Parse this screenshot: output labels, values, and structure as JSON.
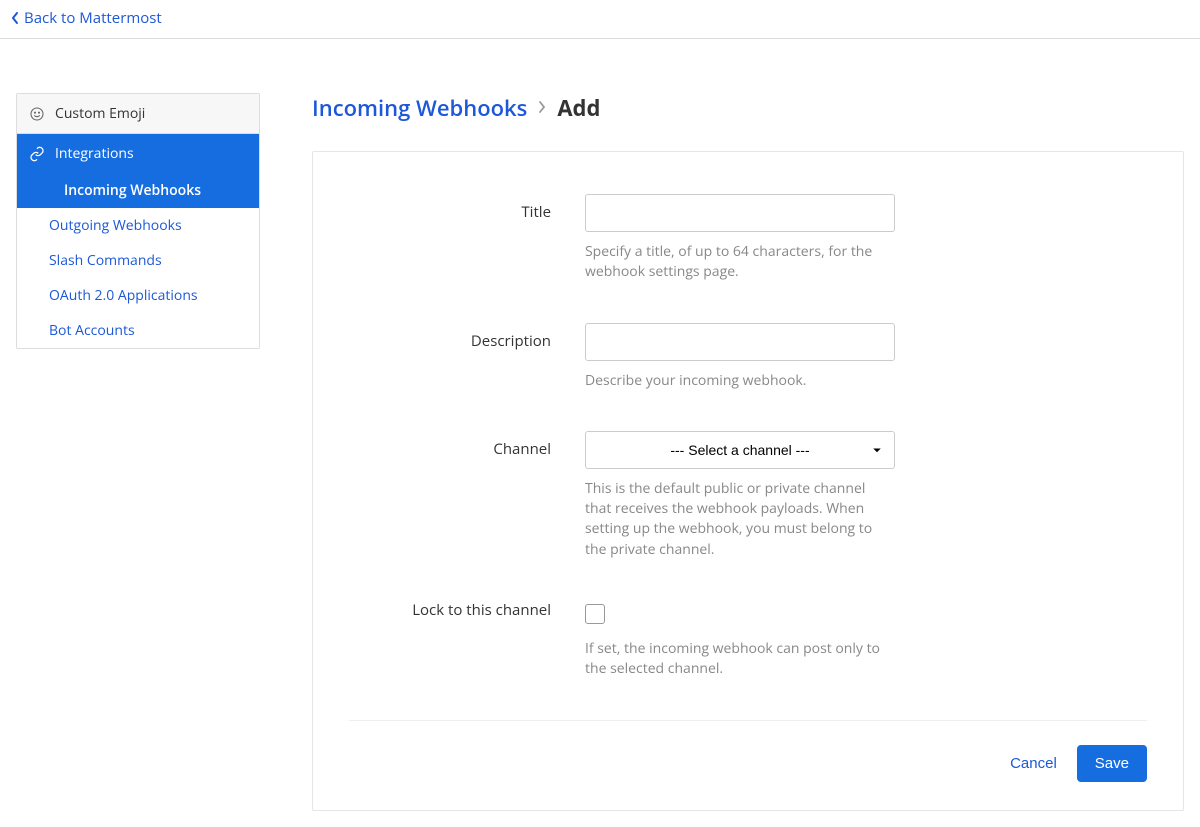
{
  "topbar": {
    "back_label": "Back to Mattermost"
  },
  "sidebar": {
    "emoji_label": "Custom Emoji",
    "integrations_label": "Integrations",
    "subitems": [
      "Incoming Webhooks",
      "Outgoing Webhooks",
      "Slash Commands",
      "OAuth 2.0 Applications",
      "Bot Accounts"
    ]
  },
  "breadcrumb": {
    "parent": "Incoming Webhooks",
    "current": "Add"
  },
  "form": {
    "title_label": "Title",
    "title_value": "",
    "title_help": "Specify a title, of up to 64 characters, for the webhook settings page.",
    "description_label": "Description",
    "description_value": "",
    "description_help": "Describe your incoming webhook.",
    "channel_label": "Channel",
    "channel_placeholder": "--- Select a channel ---",
    "channel_help": "This is the default public or private channel that receives the webhook payloads. When setting up the webhook, you must belong to the private channel.",
    "lock_label": "Lock to this channel",
    "lock_checked": false,
    "lock_help": "If set, the incoming webhook can post only to the selected channel."
  },
  "actions": {
    "cancel_label": "Cancel",
    "save_label": "Save"
  }
}
